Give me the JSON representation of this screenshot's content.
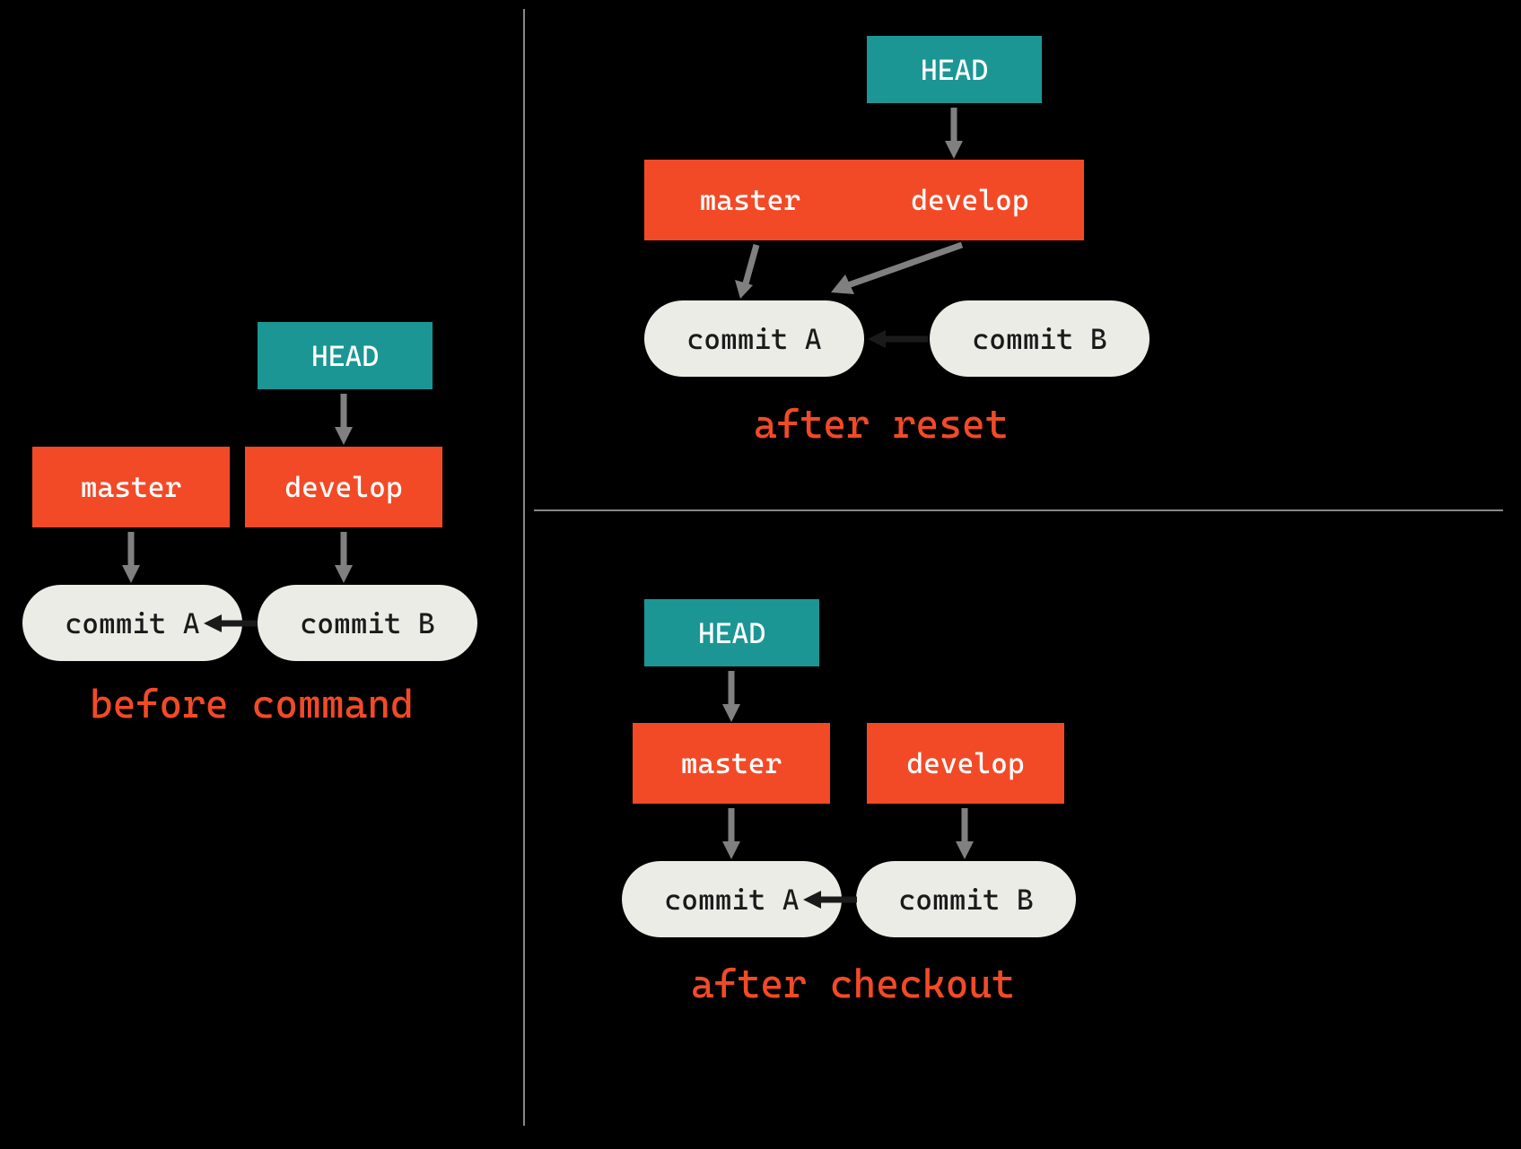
{
  "labels": {
    "head": "HEAD",
    "master": "master",
    "develop": "develop",
    "commitA": "commit A",
    "commitB": "commit B"
  },
  "captions": {
    "before": "before command",
    "afterReset": "after reset",
    "afterCheckout": "after checkout"
  }
}
